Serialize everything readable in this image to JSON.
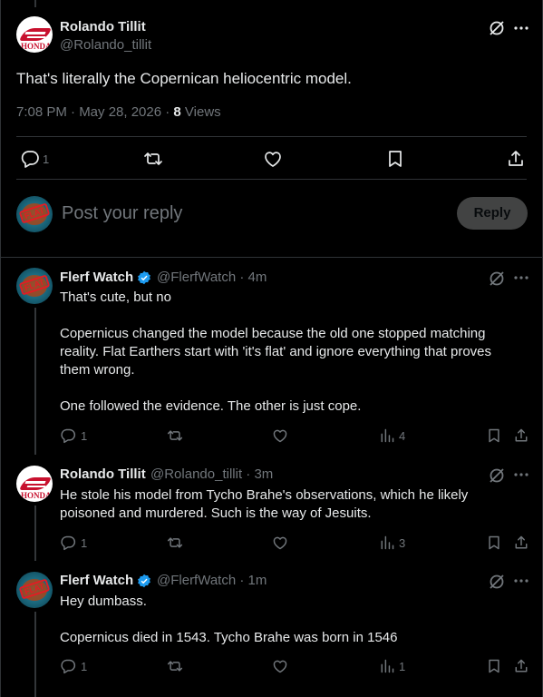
{
  "main_post": {
    "name": "Rolando Tillit",
    "handle": "@Rolando_tillit",
    "text": "That's literally the Copernican heliocentric model.",
    "time": "7:08 PM · May 28, 2026 · ",
    "views_count": "8",
    "views_label": " Views",
    "replies": "1"
  },
  "reply_box": {
    "placeholder": "Post your reply",
    "button_label": "Reply"
  },
  "replies": [
    {
      "name": "Flerf Watch",
      "handle": "@FlerfWatch",
      "time": " · 4m",
      "lines": [
        "That's cute, but no",
        "",
        "Copernicus changed the model because the old one stopped matching",
        "reality. Flat Earthers start with 'it's flat' and ignore everything that proves",
        "them wrong.",
        "",
        "One followed the evidence. The other is just cope."
      ],
      "replies": "1",
      "views": "4"
    },
    {
      "name": "Rolando Tillit",
      "handle": "@Rolando_tillit",
      "time": " · 3m",
      "lines": [
        "He stole his model from Tycho Brahe's observations, which he likely",
        "poisoned and murdered. Such is the way of Jesuits."
      ],
      "replies": "1",
      "views": "3"
    },
    {
      "name": "Flerf Watch",
      "handle": "@FlerfWatch",
      "time": " · 1m",
      "lines": [
        "Hey dumbass.",
        "",
        "Copernicus died in 1543. Tycho Brahe was born in 1546"
      ],
      "replies": "1",
      "views": "1"
    }
  ],
  "avatars": {
    "rolando_text": "HONDA",
    "flerf_text": "FLAT"
  },
  "colors": {
    "background": "#000000",
    "text": "#e7e9ea",
    "muted": "#71767b",
    "divider": "#2f3336",
    "verified": "#1d9bf0"
  }
}
